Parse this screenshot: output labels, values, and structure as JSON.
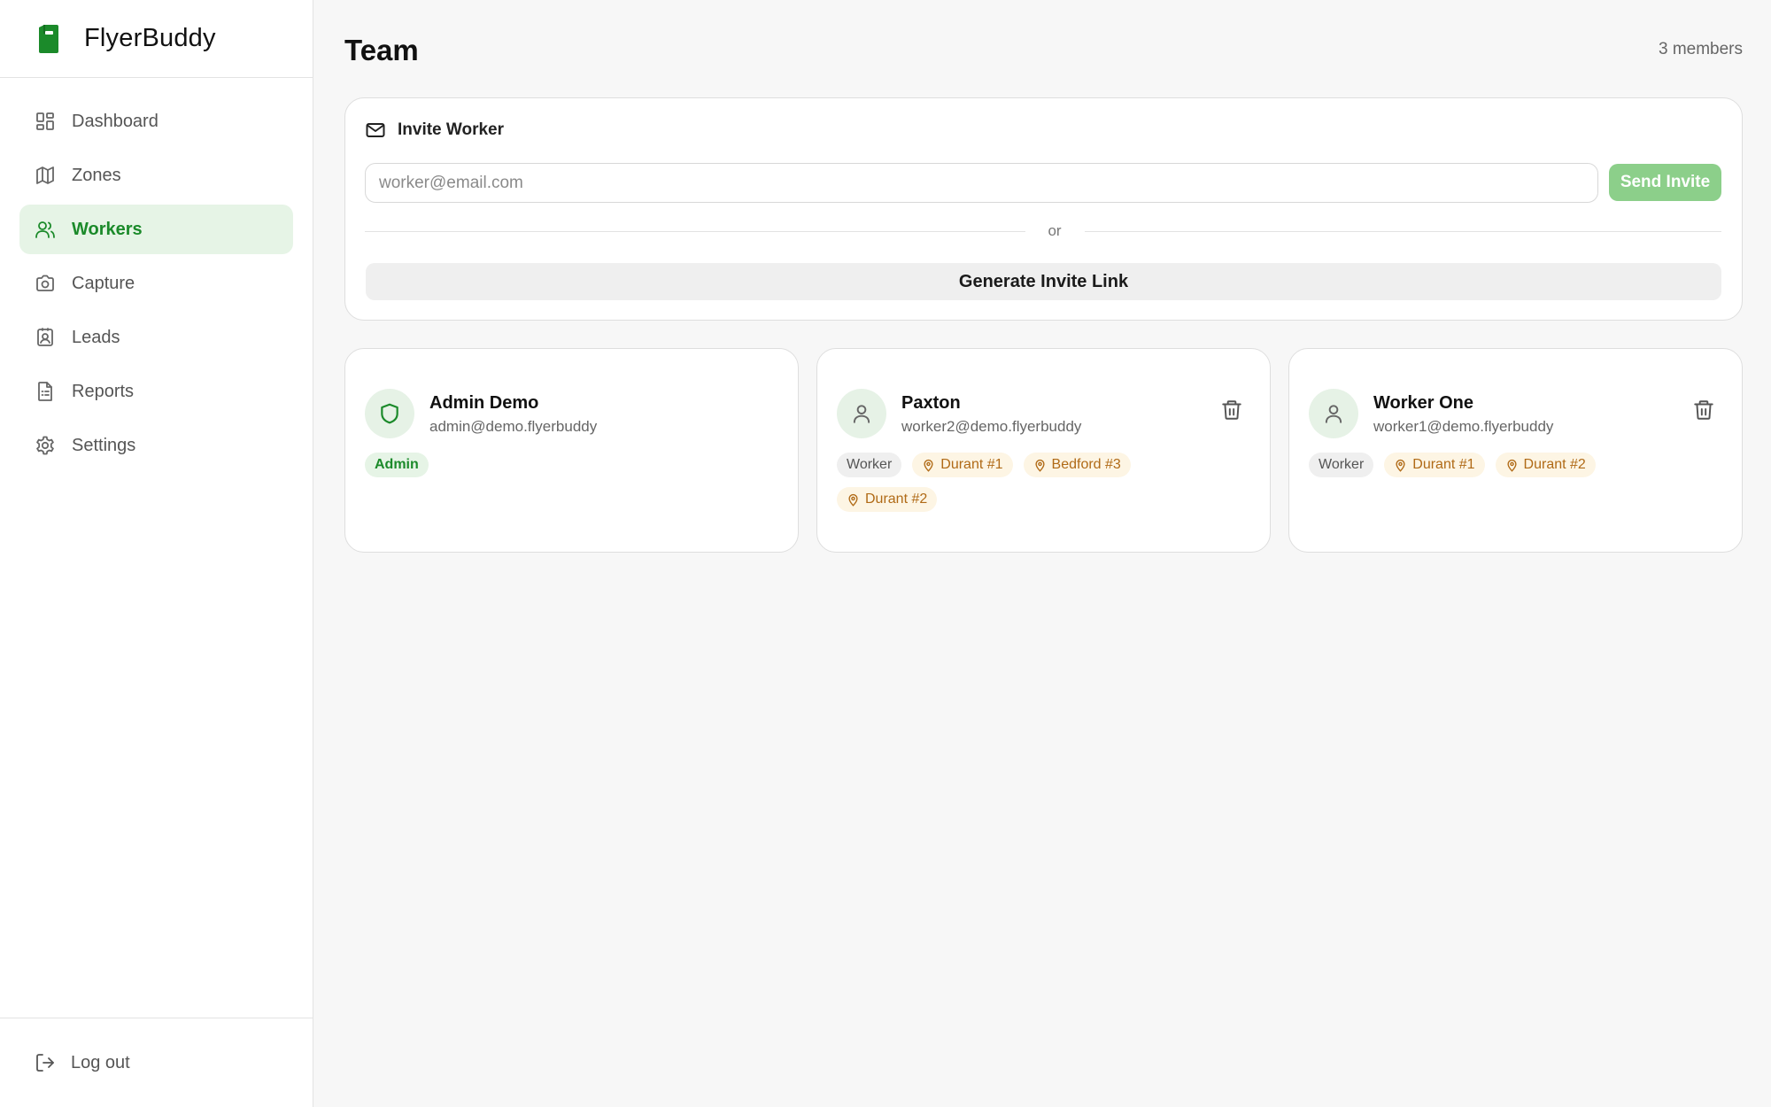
{
  "app": {
    "name": "FlyerBuddy",
    "brand_color": "#1b8a2a"
  },
  "sidebar": {
    "items": [
      {
        "label": "Dashboard",
        "icon": "dashboard-icon",
        "active": false
      },
      {
        "label": "Zones",
        "icon": "map-icon",
        "active": false
      },
      {
        "label": "Workers",
        "icon": "users-icon",
        "active": true
      },
      {
        "label": "Capture",
        "icon": "camera-icon",
        "active": false
      },
      {
        "label": "Leads",
        "icon": "contact-icon",
        "active": false
      },
      {
        "label": "Reports",
        "icon": "report-icon",
        "active": false
      },
      {
        "label": "Settings",
        "icon": "gear-icon",
        "active": false
      }
    ],
    "logout_label": "Log out"
  },
  "header": {
    "title": "Team",
    "member_count": "3 members"
  },
  "invite": {
    "title": "Invite Worker",
    "email_value": "",
    "email_placeholder": "worker@email.com",
    "send_label": "Send Invite",
    "or_label": "or",
    "generate_label": "Generate Invite Link"
  },
  "members": [
    {
      "name": "Admin Demo",
      "email": "admin@demo.flyerbuddy",
      "role": "Admin",
      "avatar_icon": "shield-icon",
      "zones": [],
      "deletable": false
    },
    {
      "name": "Paxton",
      "email": "worker2@demo.flyerbuddy",
      "role": "Worker",
      "avatar_icon": "user-icon",
      "zones": [
        "Durant #1",
        "Bedford #3",
        "Durant #2"
      ],
      "deletable": true
    },
    {
      "name": "Worker One",
      "email": "worker1@demo.flyerbuddy",
      "role": "Worker",
      "avatar_icon": "user-icon",
      "zones": [
        "Durant #1",
        "Durant #2"
      ],
      "deletable": true
    }
  ]
}
